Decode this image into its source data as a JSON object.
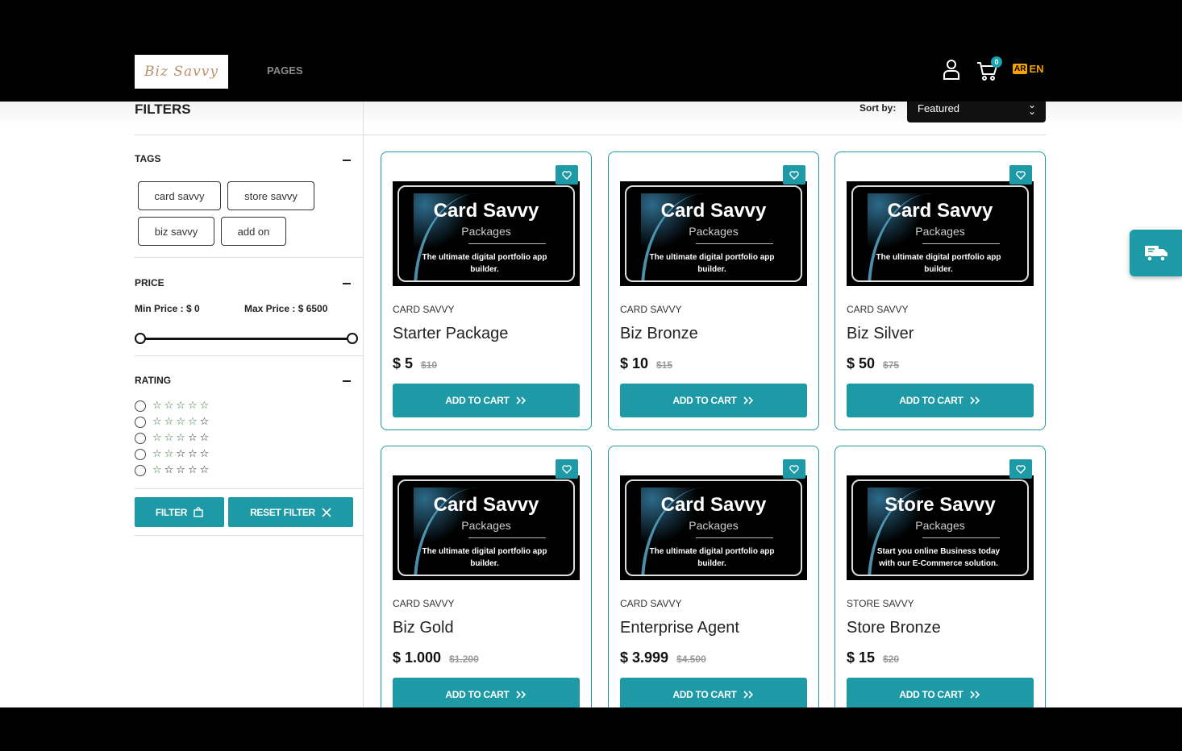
{
  "header": {
    "logo_text": "Biz Savvy",
    "nav_pages": "PAGES",
    "cart_count": "0",
    "lang_ar": "AR",
    "lang_en": "EN"
  },
  "filters": {
    "title": "FILTERS",
    "tags_title": "TAGS",
    "tags": [
      "card savvy",
      "store savvy",
      "biz savvy",
      "add on"
    ],
    "price_title": "PRICE",
    "min_price": "Min Price : $ 0",
    "max_price": "Max Price : $ 6500",
    "rating_title": "RATING",
    "filter_btn": "FILTER",
    "reset_btn": "RESET FILTER"
  },
  "sort": {
    "label": "Sort by:",
    "selected": "Featured"
  },
  "products": [
    {
      "category": "CARD SAVVY",
      "name": "Starter Package",
      "price": "$ 5",
      "old_price": "$10",
      "img_title": "Card Savvy",
      "img_sub": "Packages",
      "img_desc": "The ultimate digital portfolio app builder.",
      "cta": "ADD TO CART"
    },
    {
      "category": "CARD SAVVY",
      "name": "Biz Bronze",
      "price": "$ 10",
      "old_price": "$15",
      "img_title": "Card Savvy",
      "img_sub": "Packages",
      "img_desc": "The ultimate digital portfolio app builder.",
      "cta": "ADD TO CART"
    },
    {
      "category": "CARD SAVVY",
      "name": "Biz Silver",
      "price": "$ 50",
      "old_price": "$75",
      "img_title": "Card Savvy",
      "img_sub": "Packages",
      "img_desc": "The ultimate digital portfolio app builder.",
      "cta": "ADD TO CART"
    },
    {
      "category": "CARD SAVVY",
      "name": "Biz Gold",
      "price": "$ 1.000",
      "old_price": "$1.200",
      "img_title": "Card Savvy",
      "img_sub": "Packages",
      "img_desc": "The ultimate digital portfolio app builder.",
      "cta": "ADD TO CART"
    },
    {
      "category": "CARD SAVVY",
      "name": "Enterprise Agent",
      "price": "$ 3.999",
      "old_price": "$4.500",
      "img_title": "Card Savvy",
      "img_sub": "Packages",
      "img_desc": "The ultimate digital portfolio app builder.",
      "cta": "ADD TO CART"
    },
    {
      "category": "STORE SAVVY",
      "name": "Store Bronze",
      "price": "$ 15",
      "old_price": "$20",
      "img_title": "Store Savvy",
      "img_sub": "Packages",
      "img_desc": "Start you online Business today with our E-Commerce solution.",
      "cta": "ADD TO CART"
    }
  ],
  "colors": {
    "accent": "#1d9aa6",
    "header_bg": "#000000",
    "lang": "#f4a300"
  },
  "icons": [
    "user-icon",
    "cart-icon",
    "heart-icon",
    "chevrons-right-icon",
    "delivery-truck-icon",
    "bag-icon",
    "close-icon",
    "chevron-down-icon"
  ]
}
